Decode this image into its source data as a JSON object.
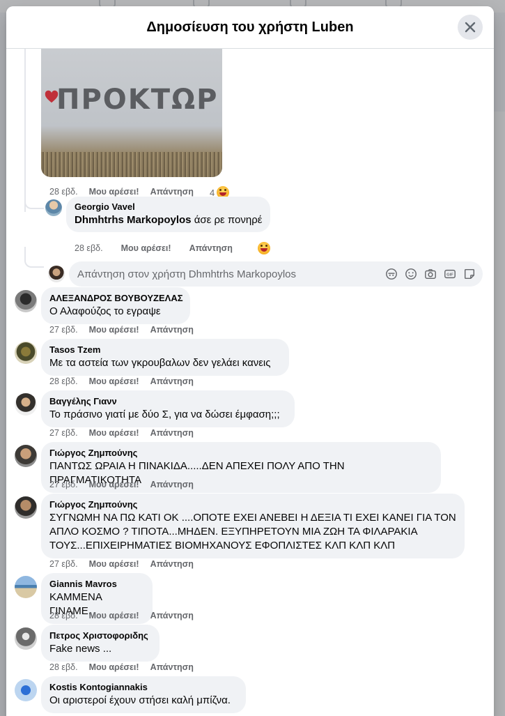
{
  "modal": {
    "title": "Δημοσίευση του χρήστη Luben",
    "close_icon": "close-icon"
  },
  "post_image": {
    "text": "ΠΡΟΚΤΩΡ",
    "heart_icon": "heart-icon"
  },
  "image_comment": {
    "time": "28 εβδ.",
    "like": "Μου αρέσει!",
    "reply": "Απάντηση",
    "reaction_count": "4"
  },
  "nested_reply": {
    "author": "Georgio Vavel",
    "mention": "Dhmhtrhs Markopoylos",
    "text": " άσε ρε πονηρέ",
    "time": "28 εβδ.",
    "like": "Μου αρέσει!",
    "reply": "Απάντηση"
  },
  "reply_input": {
    "placeholder": "Απάντηση στον χρήστη Dhmhtrhs Markopoylos",
    "icons": [
      "avatar-icon",
      "emoji-icon",
      "camera-icon",
      "gif-icon",
      "sticker-icon"
    ]
  },
  "comments": [
    {
      "author": "ΑΛΕΞΑΝΔΡΟΣ ΒΟΥΒΟΥΖΕΛΑΣ",
      "text": "Ο Αλαφούζος το εγραψε",
      "time": "27 εβδ.",
      "like": "Μου αρέσει!",
      "reply": "Απάντηση"
    },
    {
      "author": "Tasos Tzem",
      "text": "Με τα αστεία των γκρουβαλων δεν γελάει κανεις",
      "time": "28 εβδ.",
      "like": "Μου αρέσει!",
      "reply": "Απάντηση"
    },
    {
      "author": "Βαγγέλης Γιανν",
      "text": "Το πράσινο γιατί με δύο Σ, για να δώσει έμφαση;;;",
      "time": "27 εβδ.",
      "like": "Μου αρέσει!",
      "reply": "Απάντηση"
    },
    {
      "author": "Γιώργος Ζημπούνης",
      "text": "ΠΑΝΤΩΣ ΩΡΑΙΑ Η ΠΙΝΑΚΙΔΑ.....ΔΕΝ ΑΠΕΧΕΙ ΠΟΛΥ ΑΠΟ ΤΗΝ ΠΡΑΓΜΑΤΙΚΟΤΗΤΑ",
      "time": "27 εβδ.",
      "like": "Μου αρέσει!",
      "reply": "Απάντηση"
    },
    {
      "author": "Γιώργος Ζημπούνης",
      "text": "ΣΥΓΝΩΜΗ ΝΑ ΠΩ ΚΑΤΙ ΟΚ ....ΟΠΟΤΕ ΕΧΕΙ ΑΝΕΒΕΙ Η ΔΕΞΙΑ ΤΙ ΕΧΕΙ ΚΑΝΕΙ ΓΙΑ ΤΟΝ ΑΠΛΟ ΚΟΣΜΟ ? ΤΙΠΟΤΑ...ΜΗΔΕΝ. ΕΞΥΠΗΡΕΤΟΥΝ ΜΙΑ ΖΩΗ ΤΑ ΦΙΛΑΡΑΚΙΑ ΤΟΥΣ...ΕΠΙΧΕΙΡΗΜΑΤΙΕΣ ΒΙΟΜΗΧΑΝΟΥΣ ΕΦΟΠΛΙΣΤΕΣ ΚΛΠ ΚΛΠ ΚΛΠ",
      "time": "27 εβδ.",
      "like": "Μου αρέσει!",
      "reply": "Απάντηση"
    },
    {
      "author": "Giannis Mavros",
      "text": "ΚΑΜΜΕΝΑ ΓΙΝΑΜΕ.",
      "time": "28 εβδ.",
      "like": "Μου αρέσει!",
      "reply": "Απάντηση"
    },
    {
      "author": "Πετρος Χριστοφοριδης",
      "text": "Fake news ...",
      "time": "28 εβδ.",
      "like": "Μου αρέσει!",
      "reply": "Απάντηση"
    },
    {
      "author": "Kostis Kontogiannakis",
      "text": "Οι αριστεροί έχουν στήσει καλή μπίζνα.",
      "time": "",
      "like": "",
      "reply": ""
    }
  ],
  "colors": {
    "bubble": "#f0f2f5",
    "meta": "#65676b",
    "text": "#050505",
    "heart": "#c0303a"
  }
}
